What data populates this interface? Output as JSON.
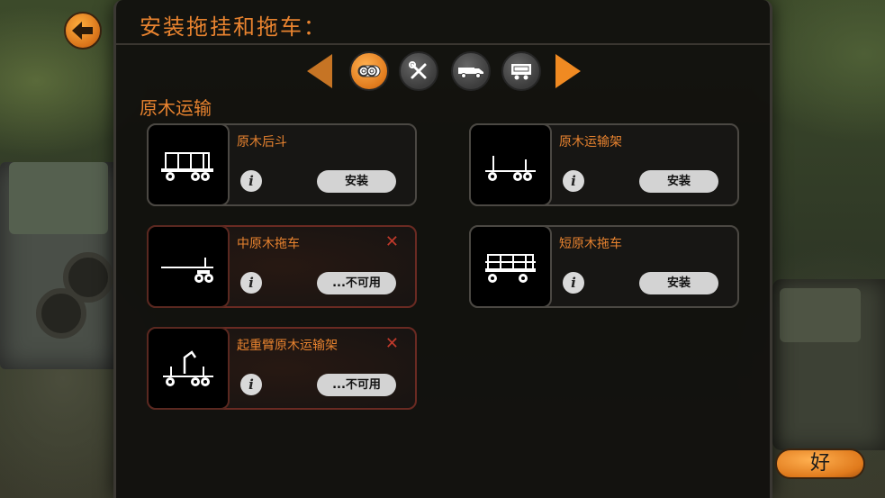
{
  "title": "安装拖挂和拖车：",
  "section_title": "原木运输",
  "tabs": [
    {
      "icon": "log-icon",
      "active": true
    },
    {
      "icon": "wrench-icon",
      "active": false
    },
    {
      "icon": "truck-icon",
      "active": false
    },
    {
      "icon": "trailer-icon",
      "active": false
    }
  ],
  "items": [
    {
      "name": "原木后斗",
      "action": "安装",
      "available": true,
      "info": "i"
    },
    {
      "name": "原木运输架",
      "action": "安装",
      "available": true,
      "info": "i"
    },
    {
      "name": "中原木拖车",
      "action": "...不可用",
      "available": false,
      "info": "i"
    },
    {
      "name": "短原木拖车",
      "action": "安装",
      "available": true,
      "info": "i"
    },
    {
      "name": "起重臂原木运输架",
      "action": "...不可用",
      "available": false,
      "info": "i"
    }
  ],
  "ok_label": "好",
  "colors": {
    "accent": "#e8832f",
    "unavailable": "#c0392b",
    "panel": "#100f0d"
  }
}
